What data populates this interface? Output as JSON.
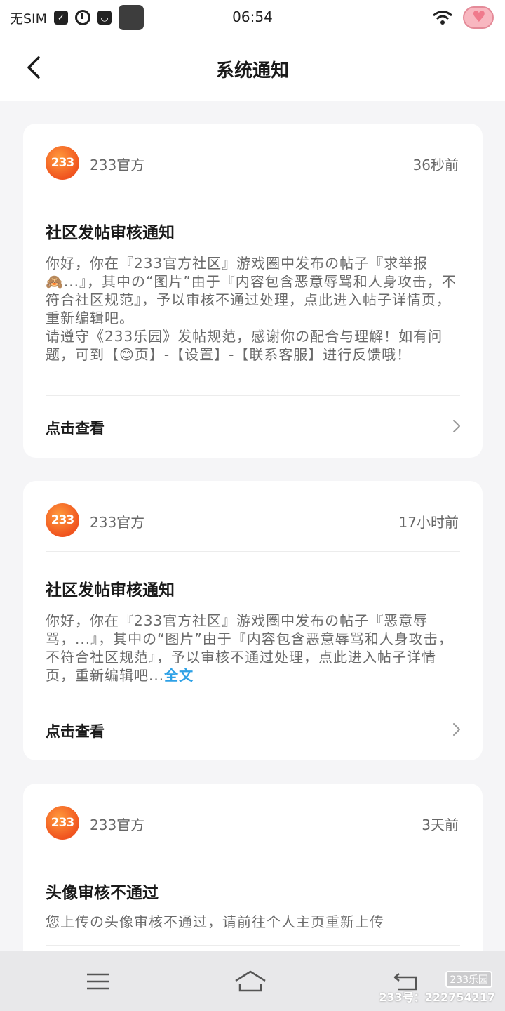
{
  "status_bar": {
    "sim_text": "无SIM",
    "time": "06:54"
  },
  "header": {
    "title": "系统通知"
  },
  "notifications": [
    {
      "publisher": "233官方",
      "logo_text": "233",
      "time_ago": "36秒前",
      "title": "社区发帖审核通知",
      "body_p1": "你好，你在『233官方社区』游戏圈中发布の帖子『求举报🙈...』，其中の“图片”由于『内容包含恶意辱骂和人身攻击，不符合社区规范』，予以审核不通过处理，点此进入帖子详情页，重新编辑吧。",
      "body_p2": "请遵守《233乐园》发帖规范，感谢你の配合与理解！如有问题，可到【😊页】-【设置】-【联系客服】进行反馈哦！",
      "view_label": "点击查看"
    },
    {
      "publisher": "233官方",
      "logo_text": "233",
      "time_ago": "17小时前",
      "title": "社区发帖审核通知",
      "body": "你好，你在『233官方社区』游戏圈中发布の帖子『恶意辱骂，...』，其中の“图片”由于『内容包含恶意辱骂和人身攻击，不符合社区规范』，予以审核不通过处理，点此进入帖子详情页，重新编辑吧...",
      "full_text_link": "全文",
      "view_label": "点击查看"
    },
    {
      "publisher": "233官方",
      "logo_text": "233",
      "time_ago": "3天前",
      "title": "头像审核不通过",
      "body": "您上传の头像审核不通过，请前往个人主页重新上传"
    }
  ],
  "watermark": {
    "badge": "233乐园",
    "id": "233号：222754217"
  },
  "icons": {
    "back": "chevron-left-icon",
    "view": "chevron-right-icon",
    "nav_menu": "menu-icon",
    "nav_home": "home-icon",
    "nav_back": "back-icon"
  },
  "colors": {
    "accent_link": "#2ea1e6",
    "logo_orange": "#f0541f",
    "page_bg": "#f5f5f7"
  }
}
